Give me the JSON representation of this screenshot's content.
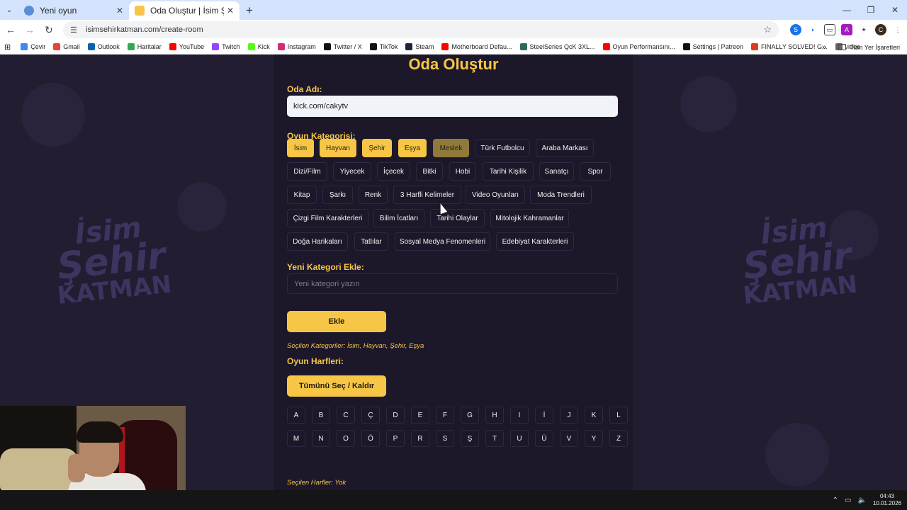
{
  "browser": {
    "tabs": [
      {
        "title": "Yeni oyun",
        "active": false,
        "favicon_color": "#5a8fd8"
      },
      {
        "title": "Oda Oluştur | İsim Şehir Katman",
        "active": true,
        "favicon_color": "#f7c646"
      }
    ],
    "url": "isimsehirkatman.com/create-room",
    "bookmarks": [
      {
        "label": "Çevir",
        "color": "#4285f4"
      },
      {
        "label": "Gmail",
        "color": "#ea4335"
      },
      {
        "label": "Outlook",
        "color": "#0a64ad"
      },
      {
        "label": "Haritalar",
        "color": "#34a853"
      },
      {
        "label": "YouTube",
        "color": "#ff0000"
      },
      {
        "label": "Twitch",
        "color": "#9146ff"
      },
      {
        "label": "Kick",
        "color": "#53fc18"
      },
      {
        "label": "Instagram",
        "color": "#d62976"
      },
      {
        "label": "Twitter / X",
        "color": "#111111"
      },
      {
        "label": "TikTok",
        "color": "#111111"
      },
      {
        "label": "Steam",
        "color": "#1b2838"
      },
      {
        "label": "Motherboard Defau...",
        "color": "#ff0000"
      },
      {
        "label": "SteelSeries QcK 3XL...",
        "color": "#2b6c5a"
      },
      {
        "label": "Oyun Performansını...",
        "color": "#ff0000"
      },
      {
        "label": "Settings | Patreon",
        "color": "#111111"
      },
      {
        "label": "FINALLY SOLVED! G...",
        "color": "#e03a1e"
      },
      {
        "label": "video",
        "color": "#666666"
      }
    ],
    "bookmarks_more": "»",
    "all_bookmarks": "Tüm Yer İşaretleri",
    "profile_initial": "C"
  },
  "page": {
    "title": "Oda Oluştur",
    "room_name_label": "Oda Adı:",
    "room_name_value": "kick.com/cakytv",
    "category_label": "Oyun Kategorisi:",
    "categories": [
      {
        "label": "İsim",
        "selected": true
      },
      {
        "label": "Hayvan",
        "selected": true
      },
      {
        "label": "Şehir",
        "selected": true
      },
      {
        "label": "Eşya",
        "selected": true
      },
      {
        "label": "Meslek",
        "selected": false,
        "hover": true
      },
      {
        "label": "Türk Futbolcu",
        "selected": false
      },
      {
        "label": "Araba Markası",
        "selected": false
      },
      {
        "label": "Dizi/Film",
        "selected": false
      },
      {
        "label": "Yiyecek",
        "selected": false
      },
      {
        "label": "İçecek",
        "selected": false
      },
      {
        "label": "Bitki",
        "selected": false
      },
      {
        "label": "Hobi",
        "selected": false
      },
      {
        "label": "Tarihi Kişilik",
        "selected": false
      },
      {
        "label": "Sanatçı",
        "selected": false
      },
      {
        "label": "Spor",
        "selected": false
      },
      {
        "label": "Kitap",
        "selected": false
      },
      {
        "label": "Şarkı",
        "selected": false
      },
      {
        "label": "Renk",
        "selected": false
      },
      {
        "label": "3 Harfli Kelimeler",
        "selected": false
      },
      {
        "label": "Video Oyunları",
        "selected": false
      },
      {
        "label": "Moda Trendleri",
        "selected": false
      },
      {
        "label": "Çizgi Film Karakterleri",
        "selected": false
      },
      {
        "label": "Bilim İcatları",
        "selected": false
      },
      {
        "label": "Tarihi Olaylar",
        "selected": false
      },
      {
        "label": "Mitolojik Kahramanlar",
        "selected": false
      },
      {
        "label": "Doğa Harikaları",
        "selected": false
      },
      {
        "label": "Tatlılar",
        "selected": false
      },
      {
        "label": "Sosyal Medya Fenomenleri",
        "selected": false
      },
      {
        "label": "Edebiyat Karakterleri",
        "selected": false
      }
    ],
    "new_category_label": "Yeni Kategori Ekle:",
    "new_category_placeholder": "Yeni kategori yazın",
    "add_button": "Ekle",
    "selected_categories": "Seçilen Kategoriler: İsim, Hayvan, Şehir, Eşya",
    "letters_label": "Oyun Harfleri:",
    "toggle_all_button": "Tümünü Seç / Kaldır",
    "letters": [
      "A",
      "B",
      "C",
      "Ç",
      "D",
      "E",
      "F",
      "G",
      "H",
      "I",
      "İ",
      "J",
      "K",
      "L",
      "M",
      "N",
      "O",
      "Ö",
      "P",
      "R",
      "S",
      "Ş",
      "T",
      "U",
      "Ü",
      "V",
      "Y",
      "Z"
    ],
    "selected_letters": "Seçilen Harfler: Yok",
    "logo_lines": [
      "İsim",
      "Şehir",
      "KATMAN"
    ],
    "accent_color": "#f7c646",
    "background_color": "#221d31"
  },
  "taskbar": {
    "time": "04:43",
    "date": "10.01.2026"
  }
}
